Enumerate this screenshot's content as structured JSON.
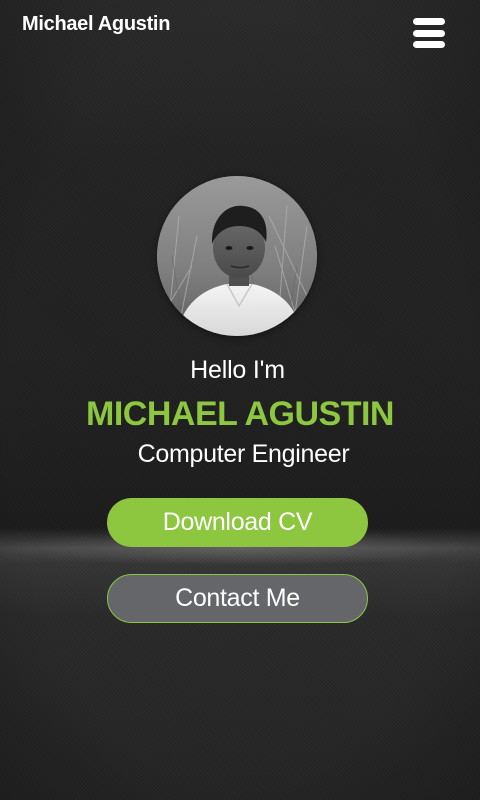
{
  "header": {
    "brand": "Michael Agustin",
    "menu_icon": "hamburger-menu-icon"
  },
  "hero": {
    "greeting": "Hello I'm",
    "name": "MICHAEL AGUSTIN",
    "role": "Computer Engineer",
    "avatar_alt": "profile photo"
  },
  "actions": {
    "download_label": "Download CV",
    "contact_label": "Contact Me"
  },
  "colors": {
    "accent": "#8dc63f",
    "secondary_button": "#64666a",
    "background": "#242424",
    "text": "#ffffff"
  }
}
